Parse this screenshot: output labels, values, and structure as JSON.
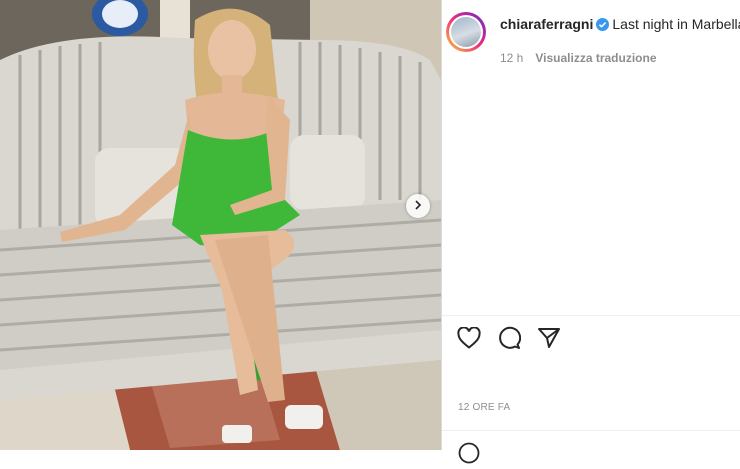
{
  "post": {
    "username": "chiaraferragni",
    "caption_text": "Last night in Marbella",
    "time_short": "12 h",
    "translate_label": "Visualizza traduzione",
    "time_long": "12 ORE FA"
  },
  "icons": {
    "verified": "verified-badge-icon",
    "like": "heart-icon",
    "comment": "comment-bubble-icon",
    "share": "paper-plane-icon",
    "next": "chevron-right-icon",
    "emoji": "smiley-icon"
  },
  "colors": {
    "verified": "#3897f0",
    "text": "#262626",
    "muted": "#8e8e8e",
    "dress": "#3fb83a"
  }
}
